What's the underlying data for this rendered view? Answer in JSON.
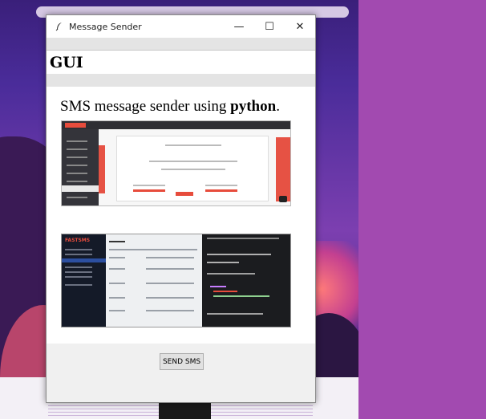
{
  "window": {
    "title": "Message Sender",
    "minimize": "—",
    "maximize": "☐",
    "close": "✕"
  },
  "header": {
    "heading": "GUI"
  },
  "main": {
    "title_plain": "SMS message sender using ",
    "title_bold": "python",
    "title_end": "."
  },
  "footer": {
    "send_label": "SEND SMS"
  },
  "screenshot2": {
    "logo_prefix": "F",
    "logo_accent": "AST",
    "logo_suffix": "SMS"
  },
  "colors": {
    "accent_red": "#e74c3c",
    "wallpaper_purple": "#a24ab0"
  },
  "icons": {
    "app": "feather-icon"
  }
}
